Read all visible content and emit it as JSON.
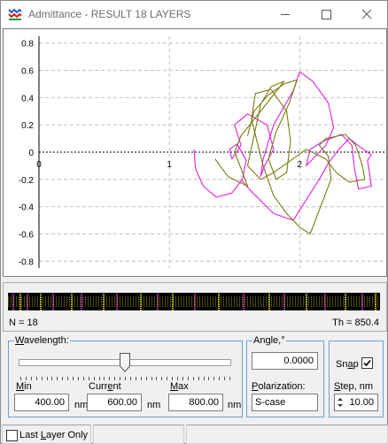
{
  "window": {
    "title": "Admittance - RESULT 18 LAYERS",
    "controls": [
      "minimize",
      "maximize",
      "close"
    ]
  },
  "chart_data": {
    "type": "line",
    "title": "",
    "xlabel": "",
    "ylabel": "",
    "xlim": [
      0,
      2.65
    ],
    "ylim": [
      -0.85,
      0.85
    ],
    "x_ticks": [
      "0",
      "1",
      "2"
    ],
    "y_ticks": [
      "0.8",
      "0.6",
      "0.4",
      "0.2",
      "0",
      "-0.2",
      "-0.4",
      "-0.6",
      "-0.8"
    ],
    "grid": true,
    "series": [
      {
        "color": "#e020e0",
        "points": [
          [
            1.19,
            0.02
          ],
          [
            1.2,
            -0.12
          ],
          [
            1.26,
            -0.25
          ],
          [
            1.36,
            -0.33
          ],
          [
            1.48,
            -0.3
          ],
          [
            1.56,
            -0.2
          ],
          [
            1.59,
            -0.06
          ],
          [
            1.52,
            0.06
          ],
          [
            1.46,
            0.02
          ],
          [
            1.48,
            -0.05
          ],
          [
            1.55,
            0.05
          ],
          [
            1.5,
            0.2
          ],
          [
            1.6,
            0.28
          ],
          [
            1.75,
            0.2
          ],
          [
            1.8,
            0.02
          ],
          [
            1.73,
            -0.1
          ],
          [
            1.7,
            -0.18
          ],
          [
            1.72,
            -0.05
          ],
          [
            1.8,
            0.2
          ],
          [
            1.95,
            0.45
          ],
          [
            2,
            0.59
          ],
          [
            2.1,
            0.52
          ],
          [
            2.22,
            0.36
          ],
          [
            2.26,
            0.18
          ],
          [
            2.2,
            0.05
          ],
          [
            2.1,
            -0.05
          ],
          [
            2.05,
            -0.1
          ],
          [
            2.08,
            0.02
          ],
          [
            2.18,
            0.08
          ],
          [
            2.32,
            0.13
          ],
          [
            2.4,
            0.05
          ],
          [
            2.42,
            -0.12
          ],
          [
            2.45,
            -0.27
          ],
          [
            2.55,
            -0.25
          ],
          [
            2.52,
            -0.06
          ],
          [
            2.55,
            -0.02
          ],
          [
            2.46,
            0.04
          ],
          [
            2.38,
            0.1
          ],
          [
            2.3,
            0.02
          ],
          [
            2.22,
            -0.08
          ],
          [
            2.15,
            -0.2
          ],
          [
            2.05,
            -0.35
          ],
          [
            1.95,
            -0.5
          ],
          [
            1.8,
            -0.45
          ],
          [
            1.62,
            -0.28
          ],
          [
            1.55,
            -0.2
          ]
        ]
      },
      {
        "color": "#7a7a10",
        "points": [
          [
            1.6,
            0.12
          ],
          [
            1.65,
            0.3
          ],
          [
            1.76,
            0.42
          ],
          [
            1.88,
            0.5
          ],
          [
            1.98,
            0.53
          ],
          [
            1.92,
            0.36
          ],
          [
            1.82,
            0.15
          ],
          [
            1.76,
            -0.05
          ],
          [
            1.82,
            -0.2
          ],
          [
            1.9,
            -0.15
          ],
          [
            1.93,
            0.08
          ],
          [
            1.9,
            0.3
          ],
          [
            1.78,
            0.46
          ],
          [
            1.66,
            0.43
          ],
          [
            1.63,
            0.24
          ],
          [
            1.72,
            -0.1
          ],
          [
            1.8,
            -0.32
          ],
          [
            1.9,
            -0.45
          ],
          [
            2,
            -0.55
          ],
          [
            2.08,
            -0.6
          ],
          [
            2.16,
            -0.4
          ],
          [
            2.24,
            -0.2
          ],
          [
            2.22,
            -0.03
          ],
          [
            2.15,
            0.05
          ],
          [
            2.2,
            0.1
          ],
          [
            2.35,
            0.13
          ],
          [
            2.43,
            0.05
          ],
          [
            2.48,
            -0.1
          ],
          [
            2.5,
            -0.2
          ],
          [
            2.38,
            -0.22
          ],
          [
            2.28,
            -0.15
          ],
          [
            2.2,
            -0.05
          ],
          [
            2.05,
            0.02
          ],
          [
            1.8,
            -0.15
          ],
          [
            1.7,
            -0.2
          ],
          [
            1.6,
            -0.1
          ],
          [
            1.65,
            0.12
          ],
          [
            1.7,
            0.35
          ],
          [
            1.78,
            0.48
          ],
          [
            1.88,
            0.52
          ],
          [
            1.75,
            0.36
          ],
          [
            1.55,
            0.12
          ],
          [
            1.5,
            0.0
          ],
          [
            1.55,
            -0.12
          ],
          [
            1.6,
            -0.25
          ],
          [
            1.45,
            -0.18
          ],
          [
            1.35,
            -0.05
          ]
        ]
      }
    ]
  },
  "layers": {
    "n_label": "N = 18",
    "th_label": "Th = 850.4",
    "stripes": [
      {
        "p": 0.012,
        "c": "#e03be0"
      },
      {
        "p": 0.03,
        "c": "#e0e020"
      },
      {
        "p": 0.05,
        "c": "#e03be0"
      },
      {
        "p": 0.085,
        "c": "#e0e020"
      },
      {
        "p": 0.12,
        "c": "#e03be0"
      },
      {
        "p": 0.17,
        "c": "#e0e020"
      },
      {
        "p": 0.195,
        "c": "#e03be0"
      },
      {
        "p": 0.255,
        "c": "#e0e020"
      },
      {
        "p": 0.29,
        "c": "#e03be0"
      },
      {
        "p": 0.355,
        "c": "#e0e020"
      },
      {
        "p": 0.4,
        "c": "#e03be0"
      },
      {
        "p": 0.44,
        "c": "#e0e020"
      },
      {
        "p": 0.5,
        "c": "#e03be0"
      },
      {
        "p": 0.565,
        "c": "#e0e020"
      },
      {
        "p": 0.63,
        "c": "#e03be0"
      },
      {
        "p": 0.7,
        "c": "#e0e020"
      },
      {
        "p": 0.74,
        "c": "#e03be0"
      },
      {
        "p": 0.8,
        "c": "#e0e020"
      },
      {
        "p": 0.85,
        "c": "#e03be0"
      },
      {
        "p": 0.905,
        "c": "#e0e020"
      },
      {
        "p": 0.95,
        "c": "#e03be0"
      },
      {
        "p": 0.985,
        "c": "#e0e020"
      }
    ]
  },
  "wavelength": {
    "group_label": "Wavelength:",
    "slider_fraction": 0.5,
    "min_label": "Min",
    "min_value": "400.00",
    "current_label": "Current",
    "current_value": "600.00",
    "max_label": "Max",
    "max_value": "800.00",
    "unit": "nm"
  },
  "angle": {
    "group_label": "Angle,°",
    "value": "0.0000",
    "polarization_label": "Polarization:",
    "polarization_value": "S-case"
  },
  "snap": {
    "label": "Snap",
    "checked": true,
    "step_label": "Step, nm",
    "step_value": "10.00"
  },
  "status": {
    "last_layer_only_label": "Last Layer Only",
    "last_layer_only_checked": false
  }
}
